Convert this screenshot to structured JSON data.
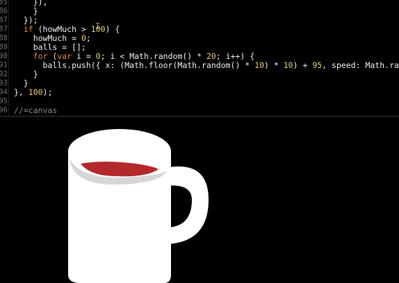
{
  "editor": {
    "lines": [
      {
        "num": "85",
        "code": "    }),",
        "tokens": [
          {
            "c": "pl",
            "t": "    }),"
          }
        ]
      },
      {
        "num": "86",
        "code": "    }",
        "tokens": [
          {
            "c": "pl",
            "t": "    }"
          }
        ]
      },
      {
        "num": "87",
        "tokens": [
          {
            "c": "pl",
            "t": "  });"
          }
        ]
      },
      {
        "num": "87",
        "tokens": [
          {
            "c": "kw",
            "t": "  if"
          },
          {
            "c": "pl",
            "t": " (howMuch > "
          },
          {
            "c": "num",
            "t": "100"
          },
          {
            "c": "pl",
            "t": ") {"
          }
        ]
      },
      {
        "num": "88",
        "tokens": [
          {
            "c": "pl",
            "t": "    howMuch = "
          },
          {
            "c": "num",
            "t": "0"
          },
          {
            "c": "pl",
            "t": ";"
          }
        ]
      },
      {
        "num": "89",
        "tokens": [
          {
            "c": "pl",
            "t": "    balls = [];"
          }
        ]
      },
      {
        "num": "90",
        "tokens": [
          {
            "c": "kw",
            "t": "    for"
          },
          {
            "c": "pl",
            "t": " ("
          },
          {
            "c": "kw",
            "t": "var"
          },
          {
            "c": "pl",
            "t": " i = "
          },
          {
            "c": "num",
            "t": "0"
          },
          {
            "c": "pl",
            "t": "; i < Math.random() * "
          },
          {
            "c": "num",
            "t": "20"
          },
          {
            "c": "pl",
            "t": "; i++) {"
          }
        ]
      },
      {
        "num": "91",
        "tokens": [
          {
            "c": "pl",
            "t": "      balls.push({ x: (Math.floor(Math.random() * "
          },
          {
            "c": "num",
            "t": "10"
          },
          {
            "c": "pl",
            "t": ") * "
          },
          {
            "c": "num",
            "t": "10"
          },
          {
            "c": "pl",
            "t": ") + "
          },
          {
            "c": "num",
            "t": "95"
          },
          {
            "c": "pl",
            "t": ", speed: Math.random()"
          }
        ]
      },
      {
        "num": "92",
        "tokens": [
          {
            "c": "pl",
            "t": "    }"
          }
        ]
      },
      {
        "num": "93",
        "tokens": [
          {
            "c": "pl",
            "t": "  }"
          }
        ]
      },
      {
        "num": "94",
        "tokens": [
          {
            "c": "pl",
            "t": "}, "
          },
          {
            "c": "num",
            "t": "100"
          },
          {
            "c": "pl",
            "t": ");"
          }
        ]
      },
      {
        "num": "95",
        "tokens": [
          {
            "c": "pl",
            "t": ""
          }
        ]
      },
      {
        "num": "96",
        "tokens": [
          {
            "c": "cm",
            "t": "//=canvas"
          }
        ]
      }
    ]
  },
  "canvas": {
    "mug_color": "#ffffff",
    "liquid_color": "#b3282b",
    "rim_shadow_color": "#d6d6d6",
    "background": "#000000"
  },
  "cursor": {
    "icon": "mouse-cursor-icon"
  }
}
